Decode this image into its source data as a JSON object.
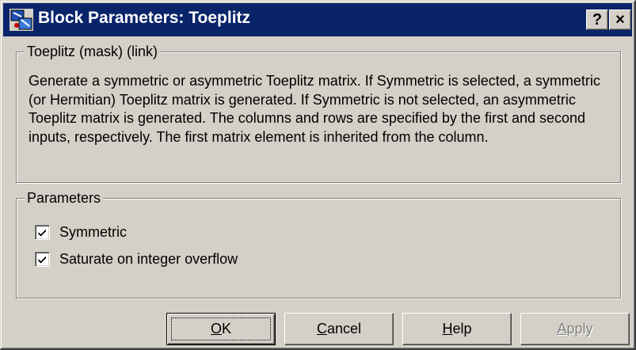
{
  "window": {
    "title": "Block Parameters: Toeplitz",
    "help_glyph": "?",
    "close_glyph": "×",
    "icon": "simulink-block-icon"
  },
  "description": {
    "group_label": "Toeplitz (mask) (link)",
    "text": "Generate a symmetric or asymmetric Toeplitz matrix.  If Symmetric is selected, a symmetric (or Hermitian) Toeplitz matrix is generated. If Symmetric is not selected, an asymmetric Toeplitz matrix is generated.  The columns and rows are specified by the first and second inputs, respectively. The first matrix element is inherited from the column."
  },
  "parameters": {
    "group_label": "Parameters",
    "options": [
      {
        "label": "Symmetric",
        "checked": true
      },
      {
        "label": "Saturate on integer overflow",
        "checked": true
      }
    ]
  },
  "buttons": {
    "ok": {
      "mnemonic": "O",
      "rest": "K",
      "enabled": true
    },
    "cancel": {
      "mnemonic": "C",
      "rest": "ancel",
      "enabled": true
    },
    "help": {
      "mnemonic": "H",
      "rest": "elp",
      "enabled": true
    },
    "apply": {
      "mnemonic": "A",
      "rest": "pply",
      "enabled": false
    }
  },
  "colors": {
    "titlebar": "#0a246a",
    "face": "#d4d0c8",
    "disabled_text": "#808080"
  }
}
